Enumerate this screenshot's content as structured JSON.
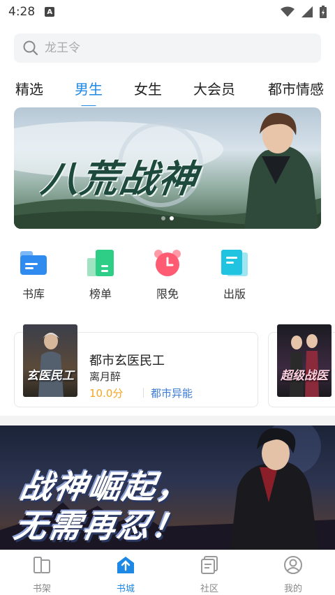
{
  "status": {
    "time": "4:28",
    "badge": "A"
  },
  "search": {
    "placeholder": "龙王令"
  },
  "tabs": [
    {
      "label": "精选",
      "active": false
    },
    {
      "label": "男生",
      "active": true
    },
    {
      "label": "女生",
      "active": false
    },
    {
      "label": "大会员",
      "active": false
    },
    {
      "label": "都市情感",
      "active": false
    }
  ],
  "banner": {
    "title": "八荒战神",
    "slides": 2,
    "current_slide": 2
  },
  "quick_nav": [
    {
      "label": "书库",
      "icon": "library-icon"
    },
    {
      "label": "榜单",
      "icon": "ranking-icon"
    },
    {
      "label": "限免",
      "icon": "free-clock-icon"
    },
    {
      "label": "出版",
      "icon": "publish-icon"
    }
  ],
  "books": [
    {
      "title": "都市玄医民工",
      "author": "离月醉",
      "score": "10.0分",
      "genre": "都市异能",
      "cover_text": "玄医民工"
    },
    {
      "title": "",
      "author": "",
      "score": "",
      "genre": "",
      "cover_text": "超级战医"
    }
  ],
  "promo": {
    "line1": "战神崛起，",
    "line2": "无需再忍！"
  },
  "bottom_nav": [
    {
      "label": "书架",
      "icon": "bookshelf-icon",
      "active": false
    },
    {
      "label": "书城",
      "icon": "bookstore-icon",
      "active": true
    },
    {
      "label": "社区",
      "icon": "community-icon",
      "active": false
    },
    {
      "label": "我的",
      "icon": "profile-icon",
      "active": false
    }
  ],
  "colors": {
    "accent": "#1e88e5",
    "score": "#f5a623",
    "genre": "#3b7bd4"
  }
}
